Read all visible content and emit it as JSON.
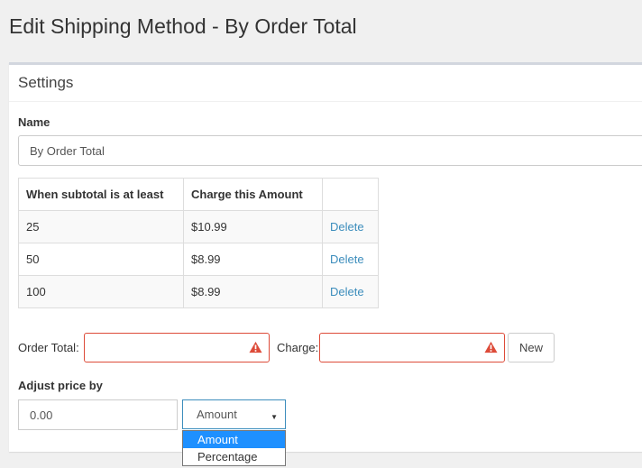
{
  "page": {
    "title": "Edit Shipping Method - By Order Total"
  },
  "settings": {
    "title": "Settings",
    "name_label": "Name",
    "name_value": "By Order Total"
  },
  "table": {
    "headers": [
      "When subtotal is at least",
      "Charge this Amount",
      ""
    ],
    "rows": [
      {
        "subtotal": "25",
        "charge": "$10.99",
        "action": "Delete"
      },
      {
        "subtotal": "50",
        "charge": "$8.99",
        "action": "Delete"
      },
      {
        "subtotal": "100",
        "charge": "$8.99",
        "action": "Delete"
      }
    ]
  },
  "new_row": {
    "order_total_label": "Order Total:",
    "order_total_value": "",
    "charge_label": "Charge:",
    "charge_value": "",
    "new_button": "New",
    "error_icon": "warning-triangle-icon",
    "error_color": "#dd4b39"
  },
  "adjust": {
    "label": "Adjust price by",
    "value": "0.00",
    "select_value": "Amount",
    "options": [
      "Amount",
      "Percentage"
    ],
    "selected_option": "Amount"
  },
  "colors": {
    "link": "#3c8dbc",
    "highlight": "#1e90ff"
  }
}
